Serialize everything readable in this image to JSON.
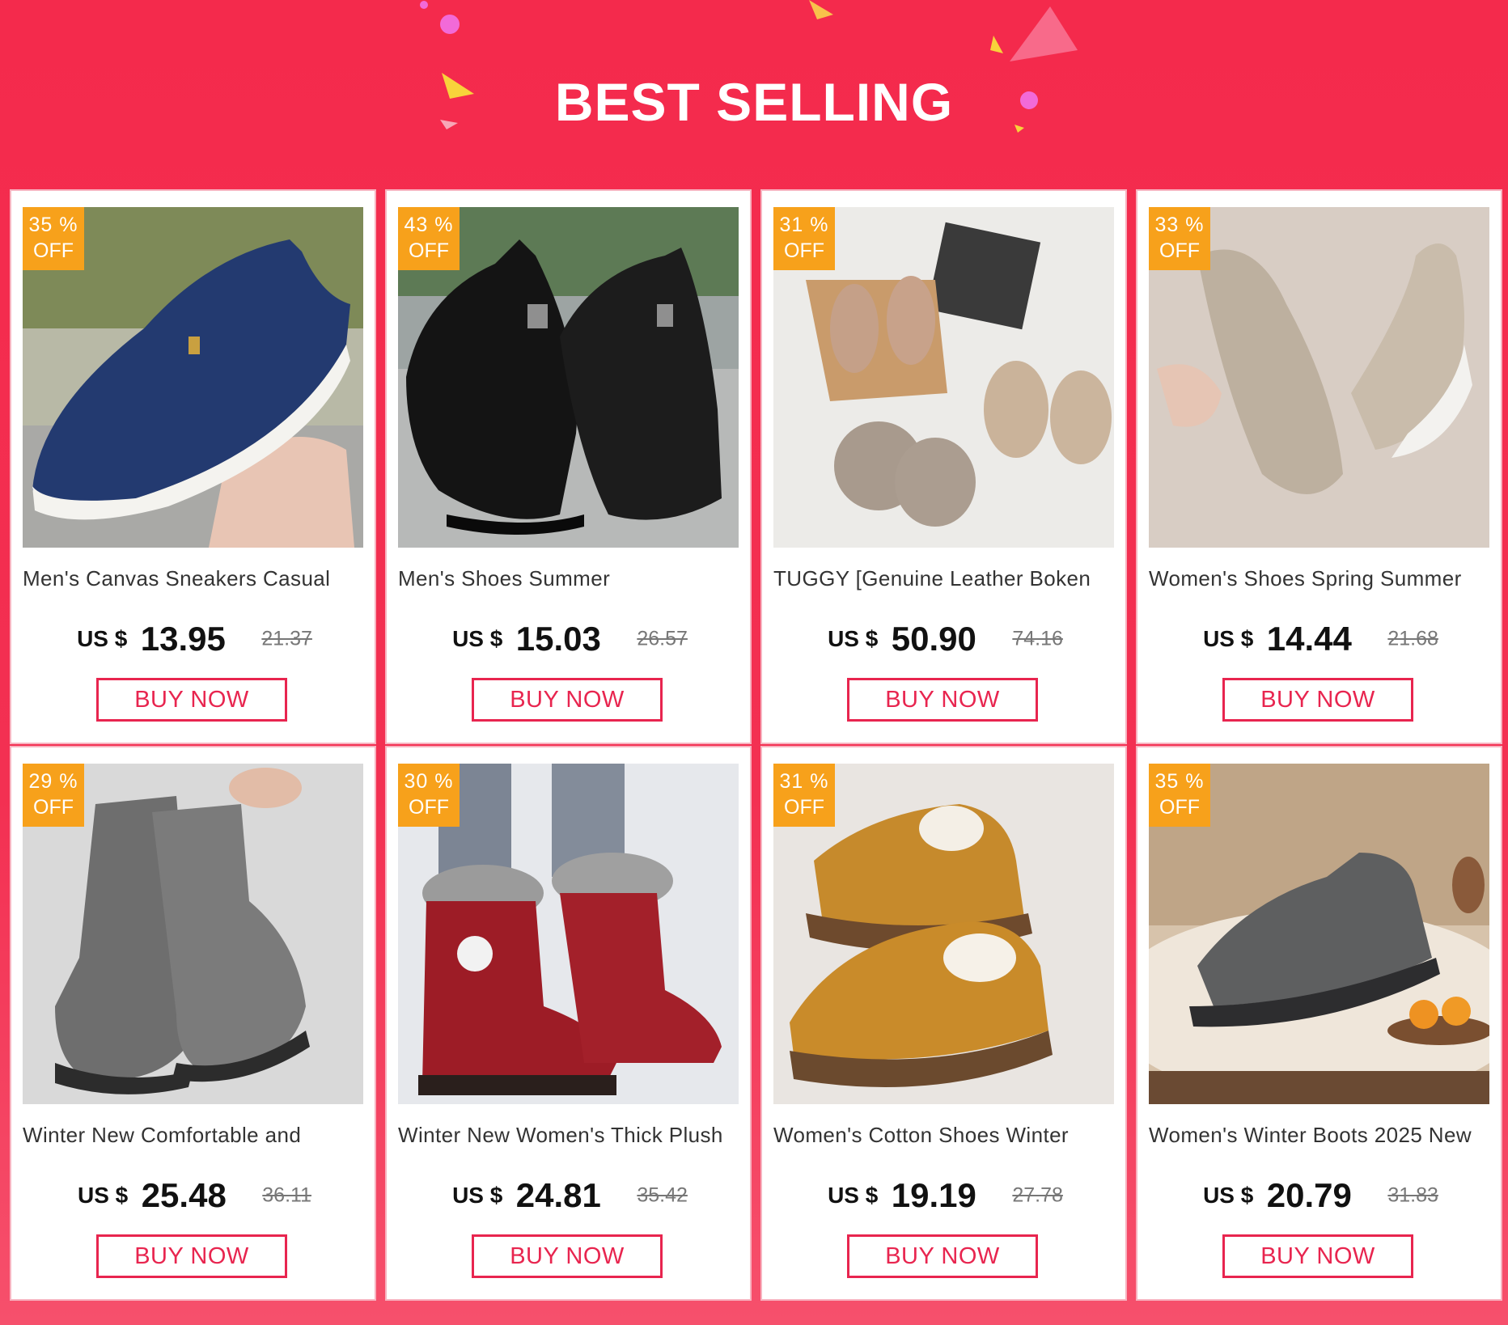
{
  "banner": {
    "title": "BEST SELLING"
  },
  "colors": {
    "accent": "#e8254f",
    "badge": "#f7a11b",
    "background": "#f42a4c"
  },
  "products": [
    {
      "discount": "35 %",
      "off": "OFF",
      "title": "Men's Canvas Sneakers Casual",
      "currency": "US $",
      "price": "13.95",
      "original_price": "21.37",
      "button": "BUY NOW",
      "image": "blue-canvas-slip-on-shoe"
    },
    {
      "discount": "43 %",
      "off": "OFF",
      "title": "Men's Shoes Summer",
      "currency": "US $",
      "price": "15.03",
      "original_price": "26.57",
      "button": "BUY NOW",
      "image": "black-knit-sneakers"
    },
    {
      "discount": "31 %",
      "off": "OFF",
      "title": "TUGGY [Genuine Leather Boken",
      "currency": "US $",
      "price": "50.90",
      "original_price": "74.16",
      "button": "BUY NOW",
      "image": "suede-clogs-in-box"
    },
    {
      "discount": "33 %",
      "off": "OFF",
      "title": "Women's Shoes Spring Summer",
      "currency": "US $",
      "price": "14.44",
      "original_price": "21.68",
      "button": "BUY NOW",
      "image": "beige-knit-loafer"
    },
    {
      "discount": "29 %",
      "off": "OFF",
      "title": "Winter New Comfortable and",
      "currency": "US $",
      "price": "25.48",
      "original_price": "36.11",
      "button": "BUY NOW",
      "image": "grey-snow-boots"
    },
    {
      "discount": "30 %",
      "off": "OFF",
      "title": "Winter New Women's Thick Plush",
      "currency": "US $",
      "price": "24.81",
      "original_price": "35.42",
      "button": "BUY NOW",
      "image": "red-plush-boots"
    },
    {
      "discount": "31 %",
      "off": "OFF",
      "title": "Women's Cotton Shoes Winter",
      "currency": "US $",
      "price": "19.19",
      "original_price": "27.78",
      "button": "BUY NOW",
      "image": "tan-fleece-shoes"
    },
    {
      "discount": "35 %",
      "off": "OFF",
      "title": "Women's Winter Boots 2025 New",
      "currency": "US $",
      "price": "20.79",
      "original_price": "31.83",
      "button": "BUY NOW",
      "image": "grey-ankle-boot"
    }
  ]
}
